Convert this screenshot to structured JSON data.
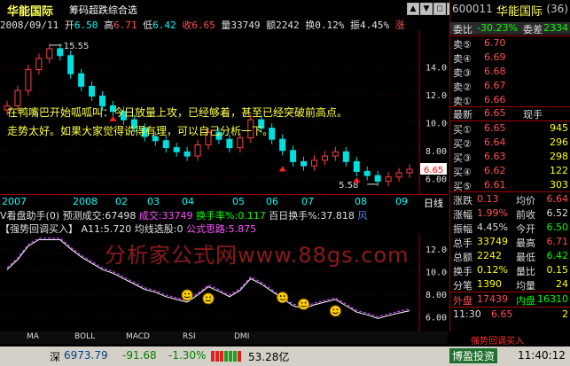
{
  "app_title": "华能国际",
  "chart_title": "筹码超跌综合选",
  "window_buttons": [
    "▲",
    "▼",
    "◻",
    "✕"
  ],
  "info": {
    "date": "2008/09/11",
    "open_label": "开",
    "open": "6.50",
    "high_label": "高",
    "high": "6.71",
    "low_label": "低",
    "low": "6.42",
    "close_label": "收",
    "close": "6.65",
    "vol_label": "量",
    "vol": "33749",
    "amt_label": "额",
    "amt": "2242",
    "turn_label": "换",
    "turn": "0.12%",
    "amp_label": "振",
    "amp": "4.45%",
    "tail": "涨"
  },
  "price_axis": [
    "14.00",
    "12.00",
    "10.00",
    "8.00",
    "6.00"
  ],
  "price_annotations": {
    "high": "15.55",
    "low": "5.58",
    "current": "6.65"
  },
  "messages": [
    "在鸭嘴巴开始呱呱叫：今日放量上攻，已经够着，甚至已经突破前高点。",
    "走势太好。如果大家觉得说得有理，可以自己分析一下。"
  ],
  "dates": [
    "2007",
    "2008",
    "02",
    "03",
    "04",
    "05",
    "06",
    "07",
    "08",
    "09"
  ],
  "period": "日线",
  "volume_info": {
    "name": "V看盘助手(0)",
    "pred_label": "预测成交:",
    "pred": "67498",
    "deal_label": "成交:",
    "deal": "33749",
    "turnrate_label": "换手率%:",
    "turnrate": "0.117",
    "hundred_label": "百日换手%:",
    "hundred": "37.818",
    "tail": "风"
  },
  "indicator_info": {
    "name": "【强势回调买入】",
    "a11_label": "A11:",
    "a11": "5.720",
    "select_label": "均线选股:",
    "select": "0",
    "formula_label": "公式思路:",
    "formula": "5.875"
  },
  "indicator_axis": [
    "12.00",
    "10.00",
    "8.00",
    "6.00"
  ],
  "watermark": "分析家公式网www.88gs.com",
  "bottom_tabs": [
    "MA",
    "BOLL",
    "MACD",
    "RSI",
    "DMI"
  ],
  "status": {
    "index_name": "深",
    "index_value": "6973.79",
    "index_change": "-91.68",
    "index_pct": "-1.30%",
    "index_amt": "53.28亿",
    "right_text": "博盈投资",
    "time": "11:40:12",
    "tray_text": "强势回调买入"
  },
  "quote": {
    "code": "600011",
    "name": "华能国际",
    "num": "(36)",
    "weibi_label": "委比",
    "weibi": "-30.23%",
    "weicha_label": "委差",
    "weicha": "2334",
    "asks": [
      {
        "label": "卖⑤",
        "price": "6.70",
        "vol": ""
      },
      {
        "label": "卖④",
        "price": "6.69",
        "vol": ""
      },
      {
        "label": "卖③",
        "price": "6.68",
        "vol": ""
      },
      {
        "label": "卖②",
        "price": "6.67",
        "vol": ""
      },
      {
        "label": "卖①",
        "price": "6.66",
        "vol": ""
      }
    ],
    "latest_label": "最新",
    "latest": "6.65",
    "current_label": "现手",
    "current": "",
    "bids": [
      {
        "label": "买①",
        "price": "6.65",
        "vol": "945"
      },
      {
        "label": "买②",
        "price": "6.64",
        "vol": "296"
      },
      {
        "label": "买③",
        "price": "6.63",
        "vol": "298"
      },
      {
        "label": "买④",
        "price": "6.62",
        "vol": "122"
      },
      {
        "label": "买⑤",
        "price": "6.61",
        "vol": "303"
      }
    ],
    "stats": [
      {
        "l1": "涨跌",
        "v1": "0.13",
        "l2": "均价",
        "v2": "6.64"
      },
      {
        "l1": "涨幅",
        "v1": "1.99%",
        "l2": "前收",
        "v2": "6.52"
      },
      {
        "l1": "振幅",
        "v1": "4.45%",
        "l2": "今开",
        "v2": "6.50"
      },
      {
        "l1": "总手",
        "v1": "33749",
        "l2": "最高",
        "v2": "6.71"
      },
      {
        "l1": "总额",
        "v1": "2242",
        "l2": "最低",
        "v2": "6.42"
      },
      {
        "l1": "换手",
        "v1": "0.12%",
        "l2": "量比",
        "v2": "0.15"
      },
      {
        "l1": "分笔",
        "v1": "1390",
        "l2": "均量",
        "v2": "24"
      }
    ],
    "outer_label": "外盘",
    "outer": "17439",
    "inner_label": "内盘",
    "inner": "16310",
    "tick_time": "11:30",
    "tick_price": "6.65",
    "tick_vol": "2"
  },
  "chart_data": {
    "type": "candlestick",
    "title": "",
    "ylim": [
      5.0,
      16.5
    ],
    "x": [
      "2007",
      "2008",
      "02",
      "03",
      "04",
      "05",
      "06",
      "07",
      "08",
      "09"
    ],
    "close_approx": [
      11.2,
      12.3,
      13.8,
      14.6,
      15.3,
      14.8,
      13.5,
      12.6,
      11.9,
      11.2,
      10.8,
      10.2,
      9.6,
      9.0,
      8.7,
      8.2,
      7.9,
      7.6,
      8.4,
      9.3,
      8.8,
      8.2,
      8.9,
      10.2,
      9.6,
      8.8,
      8.0,
      7.2,
      6.9,
      7.3,
      7.6,
      7.9,
      7.2,
      6.5,
      6.2,
      5.8,
      6.1,
      6.4,
      6.65
    ],
    "high": 15.55,
    "low": 5.58,
    "last": 6.65
  }
}
